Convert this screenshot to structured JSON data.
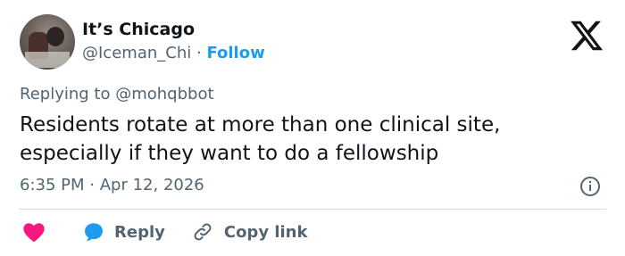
{
  "author": {
    "name": "It’s Chicago",
    "handle": "@Iceman_Chi",
    "separator": "·",
    "follow_label": "Follow"
  },
  "reply_context": {
    "prefix": "Replying to",
    "mention": "@mohqbbot"
  },
  "tweet": {
    "text": "Residents rotate at more than one clinical site, especially if they want to do a fellowship",
    "time": "6:35 PM",
    "separator": "·",
    "date": "Apr 12, 2026"
  },
  "actions": {
    "reply_label": "Reply",
    "copy_label": "Copy link"
  },
  "icons": {
    "brand": "x-logo-icon",
    "info": "info-icon",
    "like": "heart-icon",
    "reply": "speech-bubble-icon",
    "copy": "link-icon"
  },
  "colors": {
    "text": "#0f1419",
    "secondary": "#536471",
    "accent": "#1d9bf0",
    "like": "#f91880",
    "divider": "#cfd9de"
  }
}
